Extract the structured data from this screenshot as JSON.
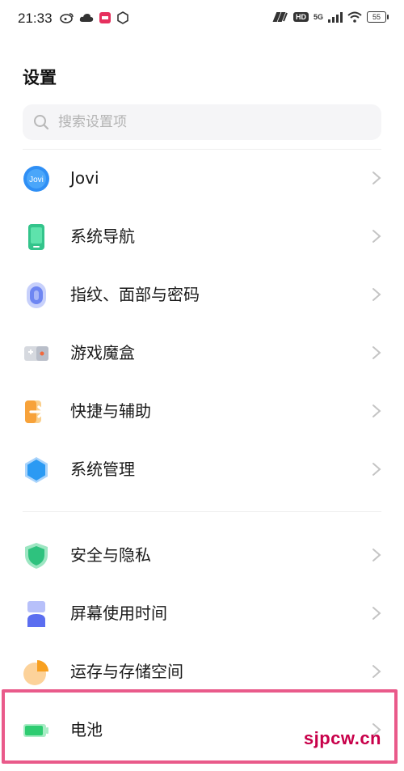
{
  "status_bar": {
    "time": "21:33",
    "network_badge": "HD",
    "signal_label": "5G",
    "battery": "55"
  },
  "page": {
    "title": "设置"
  },
  "search": {
    "placeholder": "搜索设置项"
  },
  "settings_items": [
    {
      "label": "Jovi",
      "icon": "jovi-icon",
      "icon_text": "Jovi",
      "color": "#2f8ff5"
    },
    {
      "label": "系统导航",
      "icon": "system-navigation-icon",
      "color": "#33c48b"
    },
    {
      "label": "指纹、面部与密码",
      "icon": "fingerprint-icon",
      "color": "#6e86f2"
    },
    {
      "label": "游戏魔盒",
      "icon": "game-box-icon",
      "color": "#b9bec9"
    },
    {
      "label": "快捷与辅助",
      "icon": "shortcut-icon",
      "color": "#f7a23a"
    },
    {
      "label": "系统管理",
      "icon": "system-management-icon",
      "color": "#2b9af3"
    },
    {
      "label": "安全与隐私",
      "icon": "security-shield-icon",
      "color": "#2ec27e"
    },
    {
      "label": "屏幕使用时间",
      "icon": "hourglass-icon",
      "color": "#5b6ef0"
    },
    {
      "label": "运存与存储空间",
      "icon": "storage-pie-icon",
      "color": "#f8a020"
    },
    {
      "label": "电池",
      "icon": "battery-icon",
      "color": "#2ecc71"
    }
  ],
  "watermark": "sjpcw.cn",
  "highlight_color": "#e95a8a"
}
